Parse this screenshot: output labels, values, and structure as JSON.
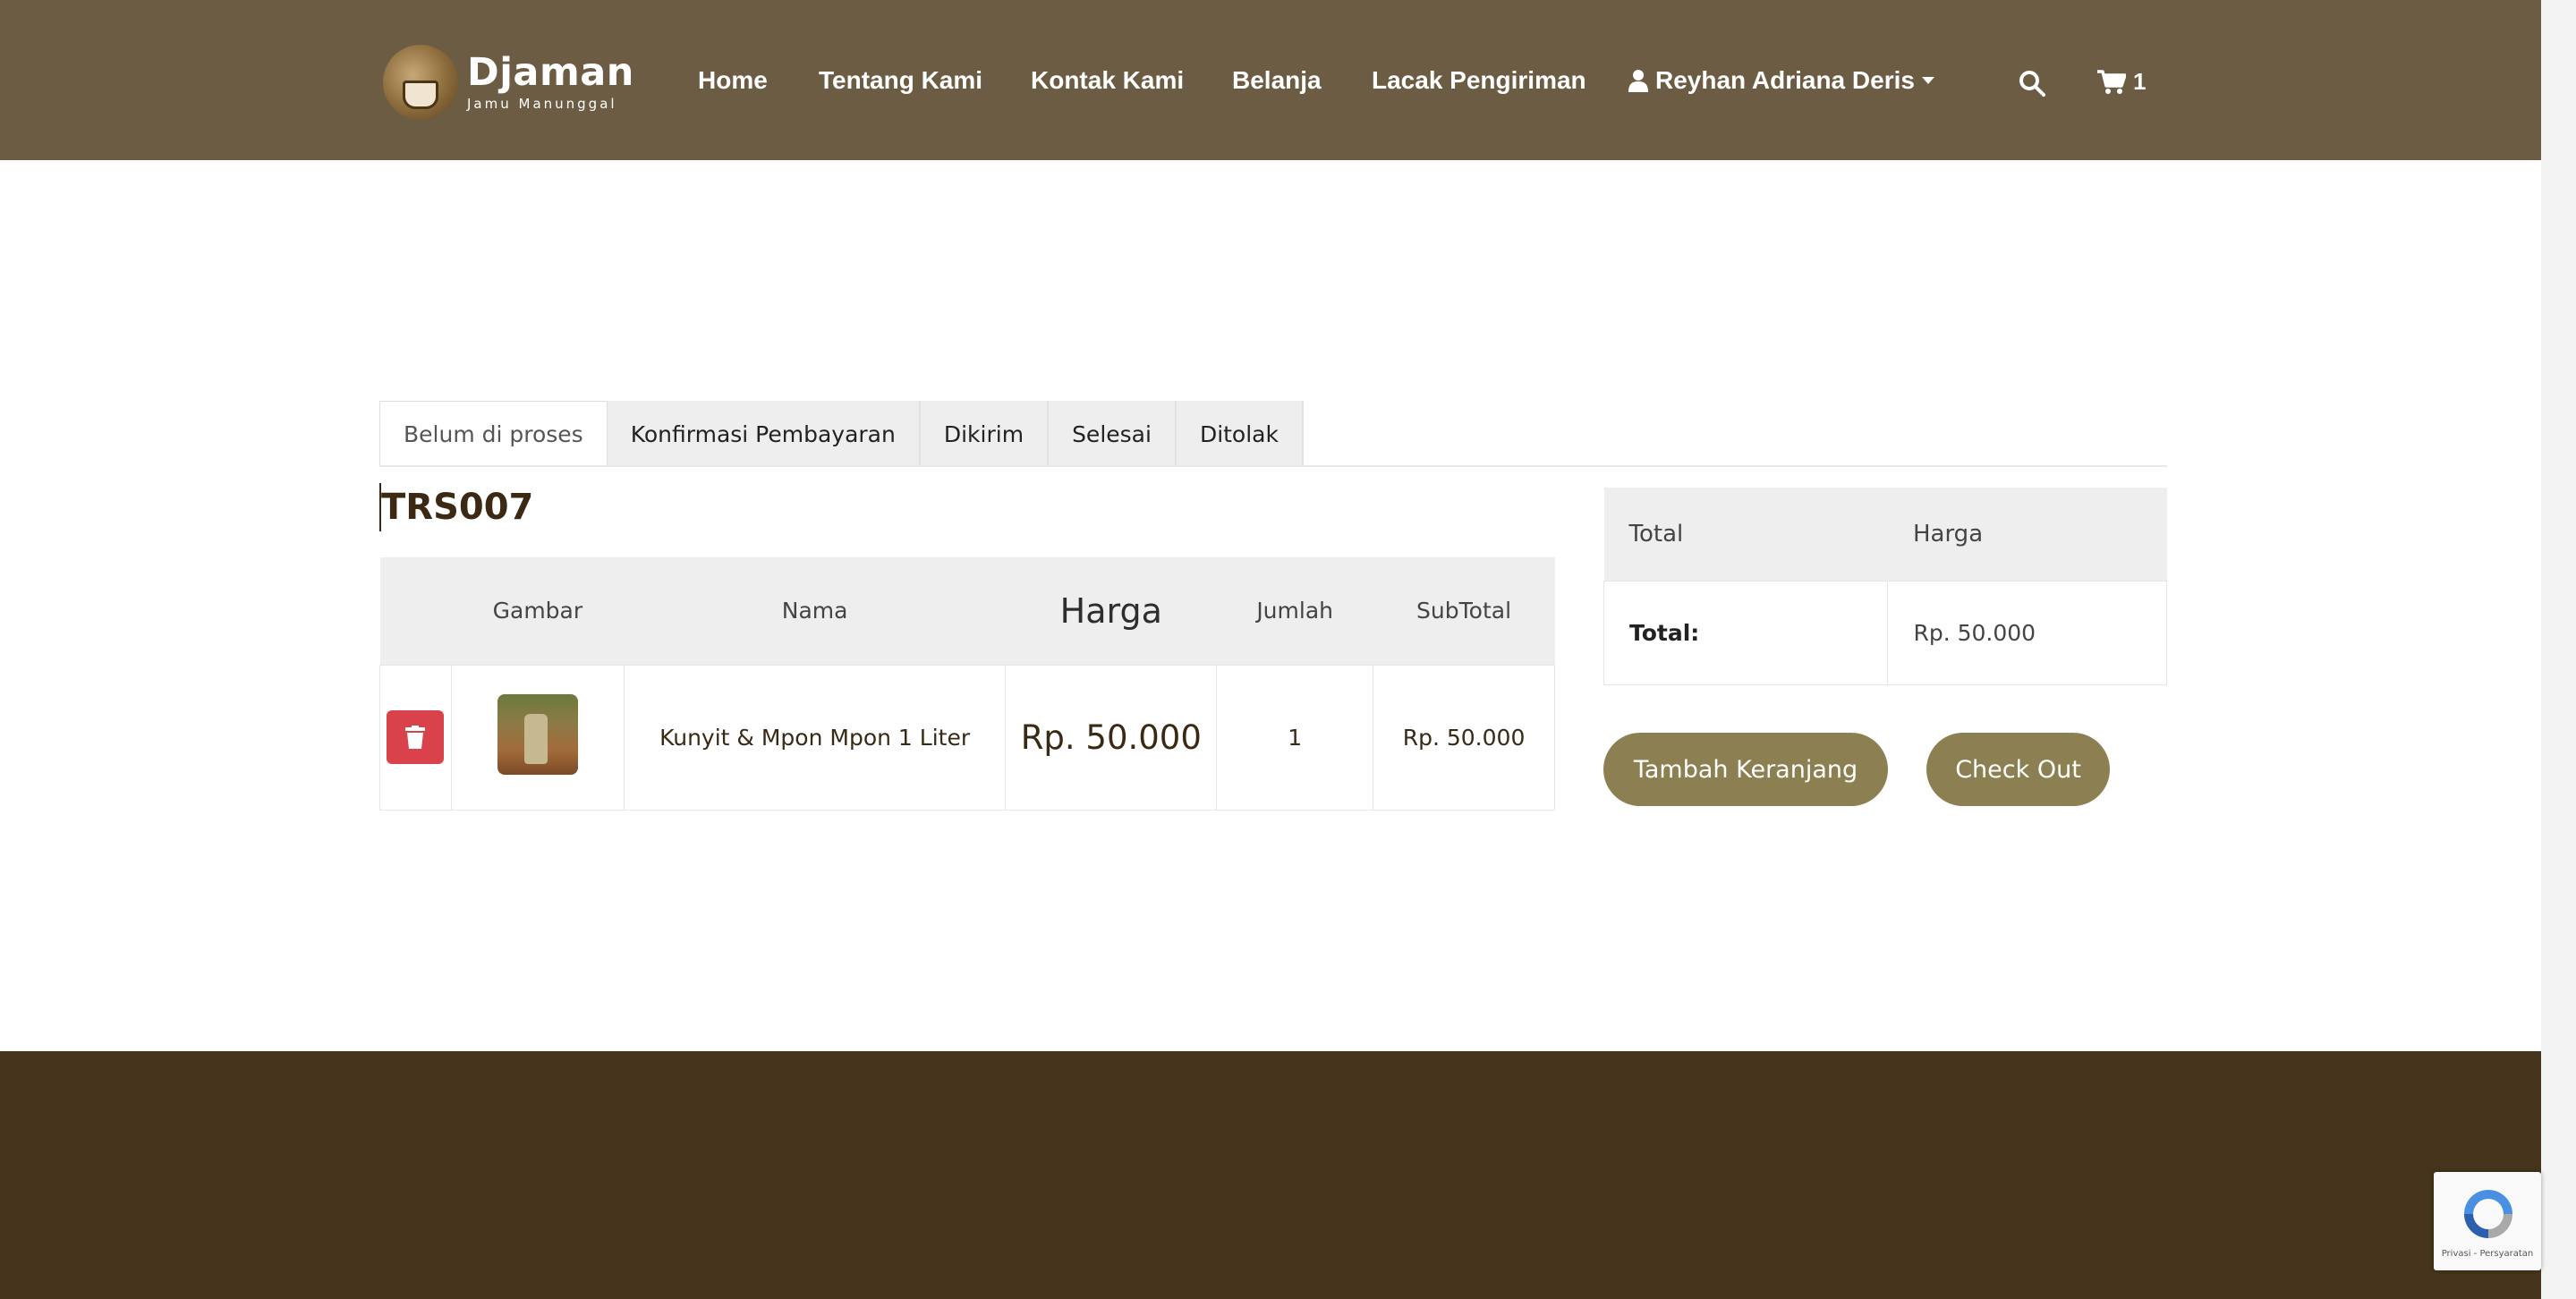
{
  "brand": {
    "title": "Djaman",
    "subtitle": "Jamu Manunggal"
  },
  "nav": {
    "items": [
      {
        "label": "Home"
      },
      {
        "label": "Tentang Kami"
      },
      {
        "label": "Kontak Kami"
      },
      {
        "label": "Belanja"
      },
      {
        "label": "Lacak Pengiriman"
      }
    ],
    "user": "Reyhan Adriana Deris",
    "cart_count": "1"
  },
  "tabs": [
    {
      "label": "Belum di proses",
      "active": true
    },
    {
      "label": "Konfirmasi Pembayaran"
    },
    {
      "label": "Dikirim"
    },
    {
      "label": "Selesai"
    },
    {
      "label": "Ditolak"
    }
  ],
  "order": {
    "id": "TRS007",
    "columns": [
      "",
      "Gambar",
      "Nama",
      "Harga",
      "Jumlah",
      "SubTotal"
    ],
    "rows": [
      {
        "name": "Kunyit & Mpon Mpon 1 Liter",
        "price": "Rp. 50.000",
        "qty": "1",
        "subtotal": "Rp. 50.000"
      }
    ]
  },
  "summary": {
    "col_total": "Total",
    "col_harga": "Harga",
    "total_label": "Total:",
    "total_value": "Rp. 50.000"
  },
  "actions": {
    "add_cart": "Tambah Keranjang",
    "checkout": "Check Out"
  },
  "recaptcha": {
    "text": "Privasi - Persyaratan"
  },
  "colors": {
    "header": "#6b5c43",
    "footer": "#46351c",
    "button": "#8c8052",
    "delete": "#d9424a"
  },
  "icons": [
    "user-icon",
    "search-icon",
    "cart-icon",
    "trash-icon",
    "recaptcha-icon"
  ]
}
